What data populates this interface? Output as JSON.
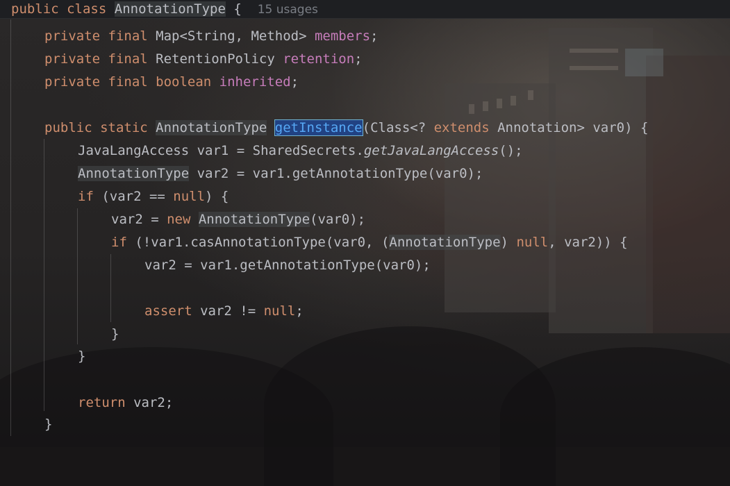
{
  "sticky_header": {
    "kw_public": "public",
    "kw_class": "class",
    "class_name": "AnnotationType",
    "brace": "{",
    "usages": "15 usages"
  },
  "code": {
    "l1": {
      "mods": "private final",
      "type": "Map<String, Method>",
      "name": "members",
      "end": ";"
    },
    "l2": {
      "mods": "private final",
      "type": "RetentionPolicy",
      "name": "retention",
      "end": ";"
    },
    "l3": {
      "mods": "private final boolean",
      "name": "inherited",
      "end": ";"
    },
    "l4": {
      "mods": "public static",
      "type": "AnnotationType",
      "fn": "getInstance",
      "p1": "(Class<? ",
      "kw_extends": "extends",
      "p2": " Annotation> var0) {"
    },
    "l5": {
      "a": "JavaLangAccess var1 = SharedSecrets.",
      "call": "getJavaLangAccess",
      "b": "();"
    },
    "l6": {
      "type": "AnnotationType",
      "a": " var2 = var1.getAnnotationType(var0);"
    },
    "l7": {
      "kw_if": "if",
      "a": " (var2 == ",
      "kw_null": "null",
      "b": ") {"
    },
    "l8": {
      "a": "var2 = ",
      "kw_new": "new",
      "type": "AnnotationType",
      "b": "(var0);"
    },
    "l9": {
      "kw_if": "if",
      "a": " (!var1.casAnnotationType(var0, (",
      "type": "AnnotationType",
      "b": ") ",
      "kw_null": "null",
      "c": ", var2)) {"
    },
    "l10": {
      "a": "var2 = var1.getAnnotationType(var0);"
    },
    "l11": {
      "kw_assert": "assert",
      "a": " var2 != ",
      "kw_null": "null",
      "b": ";"
    },
    "l12": {
      "brace": "}"
    },
    "l13": {
      "brace": "}"
    },
    "l14": {
      "kw_return": "return",
      "a": " var2;"
    },
    "l15": {
      "brace": "}"
    }
  },
  "colors": {
    "keyword": "#cf8e6d",
    "field": "#c77dbb",
    "method_decl": "#56a8f5",
    "default_text": "#bcbec4",
    "usages": "#7a7e85"
  }
}
